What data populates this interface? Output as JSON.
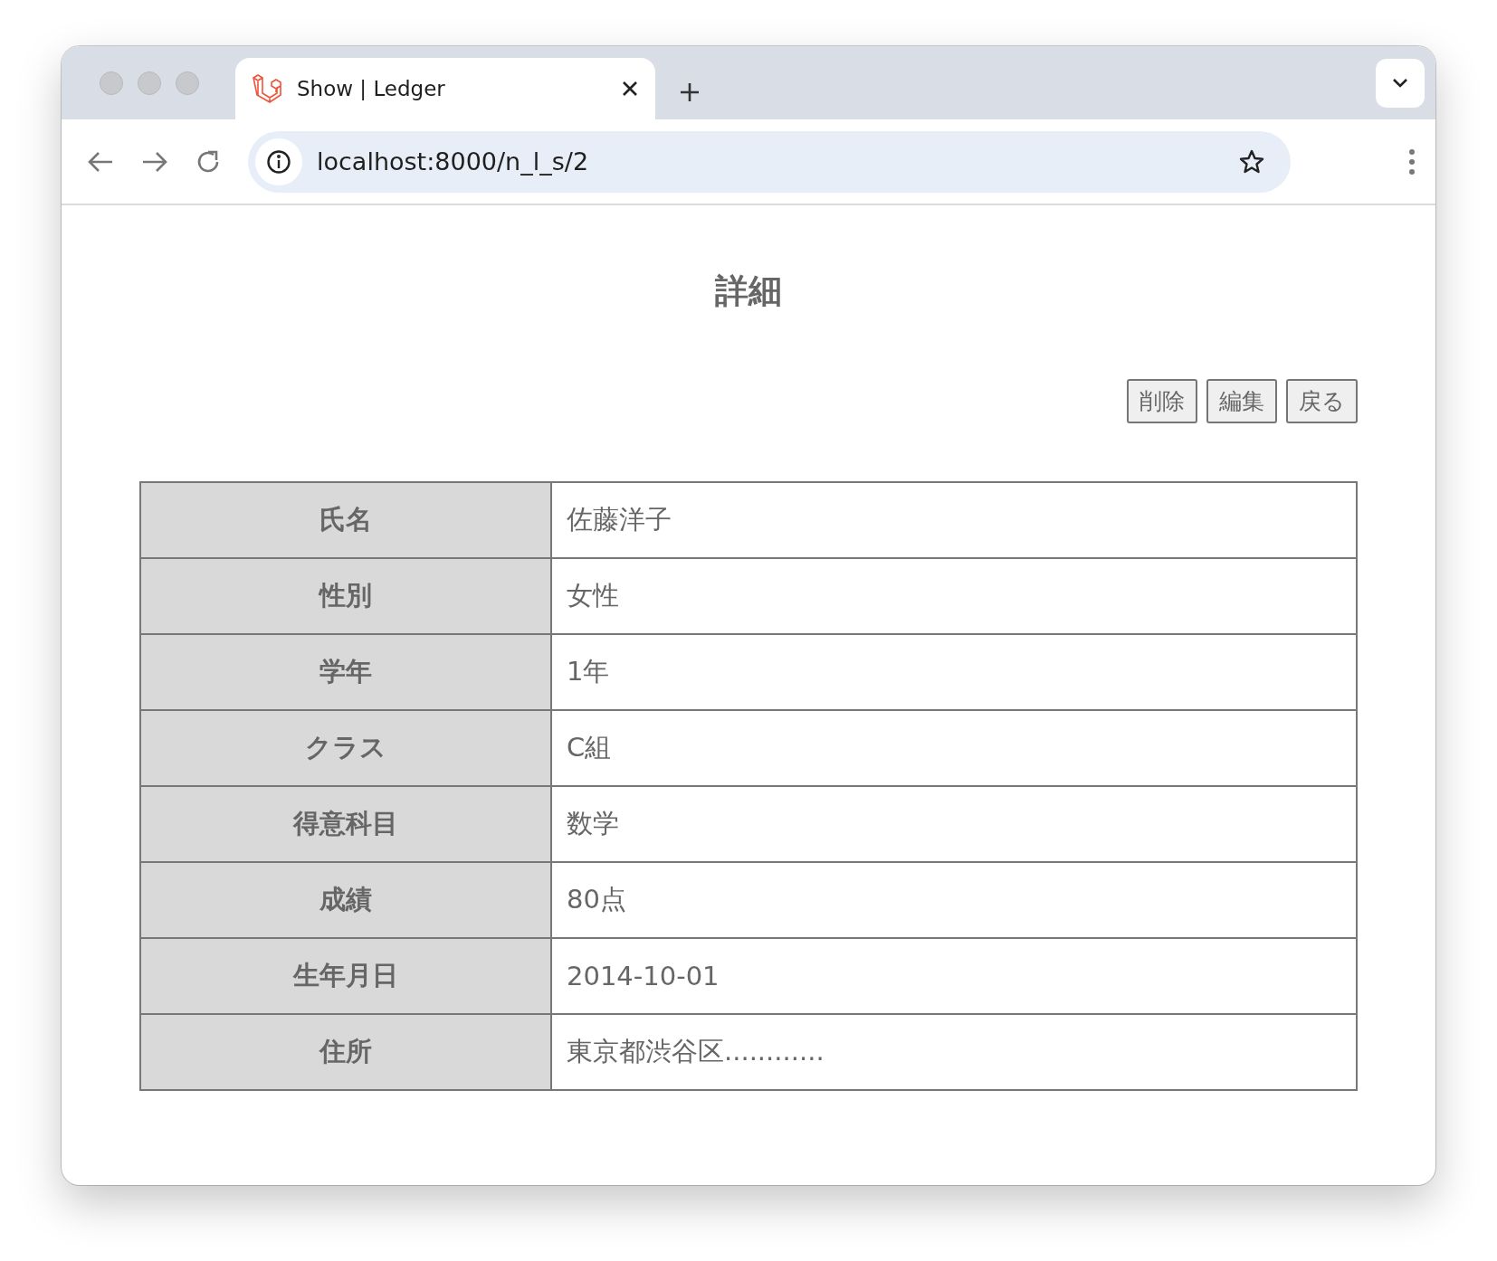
{
  "browser": {
    "tab": {
      "title": "Show | Ledger",
      "selected": true
    },
    "url": "localhost:8000/n_l_s/2"
  },
  "page": {
    "heading": "詳細",
    "buttons": [
      "削除",
      "編集",
      "戻る"
    ],
    "rows": [
      {
        "label": "氏名",
        "value": "佐藤洋子"
      },
      {
        "label": "性別",
        "value": "女性"
      },
      {
        "label": "学年",
        "value": "1年"
      },
      {
        "label": "クラス",
        "value": "C組"
      },
      {
        "label": "得意科目",
        "value": "数学"
      },
      {
        "label": "成績",
        "value": "80点"
      },
      {
        "label": "生年月日",
        "value": "2014-10-01"
      },
      {
        "label": "住所",
        "value": "東京都渋谷区............"
      }
    ]
  }
}
